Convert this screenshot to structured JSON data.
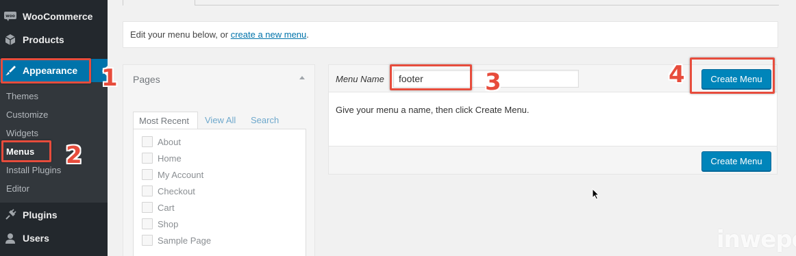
{
  "sidebar": {
    "top_items": [
      {
        "label": "WooCommerce",
        "icon": "woocommerce-icon"
      },
      {
        "label": "Products",
        "icon": "products-icon"
      },
      {
        "label": "Appearance",
        "icon": "appearance-brush-icon"
      }
    ],
    "submenu": [
      "Themes",
      "Customize",
      "Widgets",
      "Menus",
      "Install Plugins",
      "Editor"
    ],
    "bottom_items": [
      {
        "label": "Plugins",
        "icon": "plugins-icon"
      },
      {
        "label": "Users",
        "icon": "users-icon"
      }
    ],
    "woo_badge": "woo"
  },
  "notice": {
    "prefix": "Edit your menu below, or ",
    "link": "create a new menu",
    "suffix": "."
  },
  "pages_box": {
    "title": "Pages",
    "tabs": [
      "Most Recent",
      "View All",
      "Search"
    ],
    "items": [
      "About",
      "Home",
      "My Account",
      "Checkout",
      "Cart",
      "Shop",
      "Sample Page"
    ]
  },
  "menu_panel": {
    "name_label": "Menu Name",
    "name_value": "footer",
    "create_button": "Create Menu",
    "instructions": "Give your menu a name, then click Create Menu."
  },
  "annotations": [
    "1",
    "2",
    "3",
    "4"
  ],
  "watermark": "inwepo",
  "colors": {
    "sidebar_bg": "#23282d",
    "submenu_bg": "#32373c",
    "active_menu": "#0073aa",
    "button": "#0085ba",
    "callout": "#e74c3c"
  }
}
